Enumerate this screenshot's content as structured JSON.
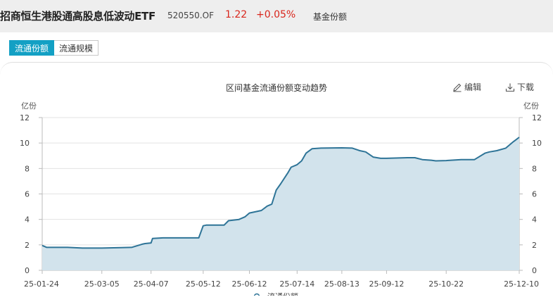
{
  "header": {
    "title": "招商恒生港股通高股息低波动ETF",
    "code": "520550.OF",
    "price": "1.22",
    "change": "+0.05%",
    "section": "基金份额"
  },
  "tabs": [
    {
      "label": "流通份额",
      "active": true
    },
    {
      "label": "流通规模",
      "active": false
    }
  ],
  "chart": {
    "title": "区间基金流通份额变动趋势",
    "edit_label": "编辑",
    "download_label": "下载",
    "y_unit_left": "亿份",
    "y_unit_right": "亿份",
    "legend_label": "流通份额"
  },
  "colors": {
    "accent": "#13a0c4",
    "line": "#2e7497",
    "fill": "#d2e3ec",
    "up": "#d9261c"
  },
  "chart_data": {
    "type": "area",
    "title": "区间基金流通份额变动趋势",
    "ylabel": "亿份",
    "ylim": [
      0,
      12
    ],
    "yticks": [
      0,
      2,
      4,
      6,
      8,
      10,
      12
    ],
    "xticks": [
      "25-01-24",
      "25-03-05",
      "25-04-07",
      "25-05-12",
      "25-06-12",
      "25-07-14",
      "25-08-13",
      "25-09-12",
      "25-10-22",
      "25-12-10"
    ],
    "series": [
      {
        "name": "流通份额",
        "points": [
          [
            "25-01-24",
            1.95
          ],
          [
            "25-01-27",
            1.8
          ],
          [
            "25-02-10",
            1.8
          ],
          [
            "25-02-20",
            1.75
          ],
          [
            "25-03-05",
            1.75
          ],
          [
            "25-03-18",
            1.78
          ],
          [
            "25-03-25",
            1.8
          ],
          [
            "25-04-01",
            2.05
          ],
          [
            "25-04-03",
            2.1
          ],
          [
            "25-04-07",
            2.15
          ],
          [
            "25-04-08",
            2.5
          ],
          [
            "25-04-15",
            2.55
          ],
          [
            "25-04-25",
            2.55
          ],
          [
            "25-05-09",
            2.55
          ],
          [
            "25-05-12",
            3.5
          ],
          [
            "25-05-14",
            3.55
          ],
          [
            "25-05-26",
            3.55
          ],
          [
            "25-05-29",
            3.9
          ],
          [
            "25-06-05",
            4.0
          ],
          [
            "25-06-09",
            4.2
          ],
          [
            "25-06-12",
            4.5
          ],
          [
            "25-06-20",
            4.7
          ],
          [
            "25-06-24",
            5.05
          ],
          [
            "25-06-27",
            5.2
          ],
          [
            "25-06-30",
            6.3
          ],
          [
            "25-07-03",
            6.8
          ],
          [
            "25-07-08",
            7.7
          ],
          [
            "25-07-10",
            8.1
          ],
          [
            "25-07-14",
            8.3
          ],
          [
            "25-07-17",
            8.6
          ],
          [
            "25-07-20",
            9.2
          ],
          [
            "25-07-24",
            9.55
          ],
          [
            "25-07-30",
            9.6
          ],
          [
            "25-08-13",
            9.62
          ],
          [
            "25-08-20",
            9.6
          ],
          [
            "25-08-25",
            9.4
          ],
          [
            "25-08-29",
            9.3
          ],
          [
            "25-09-03",
            8.9
          ],
          [
            "25-09-08",
            8.8
          ],
          [
            "25-09-12",
            8.8
          ],
          [
            "25-09-26",
            8.85
          ],
          [
            "25-10-01",
            8.85
          ],
          [
            "25-10-06",
            8.7
          ],
          [
            "25-10-12",
            8.65
          ],
          [
            "25-10-15",
            8.6
          ],
          [
            "25-10-22",
            8.62
          ],
          [
            "25-11-01",
            8.7
          ],
          [
            "25-11-10",
            8.7
          ],
          [
            "25-11-17",
            9.2
          ],
          [
            "25-11-20",
            9.3
          ],
          [
            "25-11-25",
            9.4
          ],
          [
            "25-12-01",
            9.6
          ],
          [
            "25-12-06",
            10.1
          ],
          [
            "25-12-10",
            10.45
          ]
        ]
      }
    ]
  }
}
